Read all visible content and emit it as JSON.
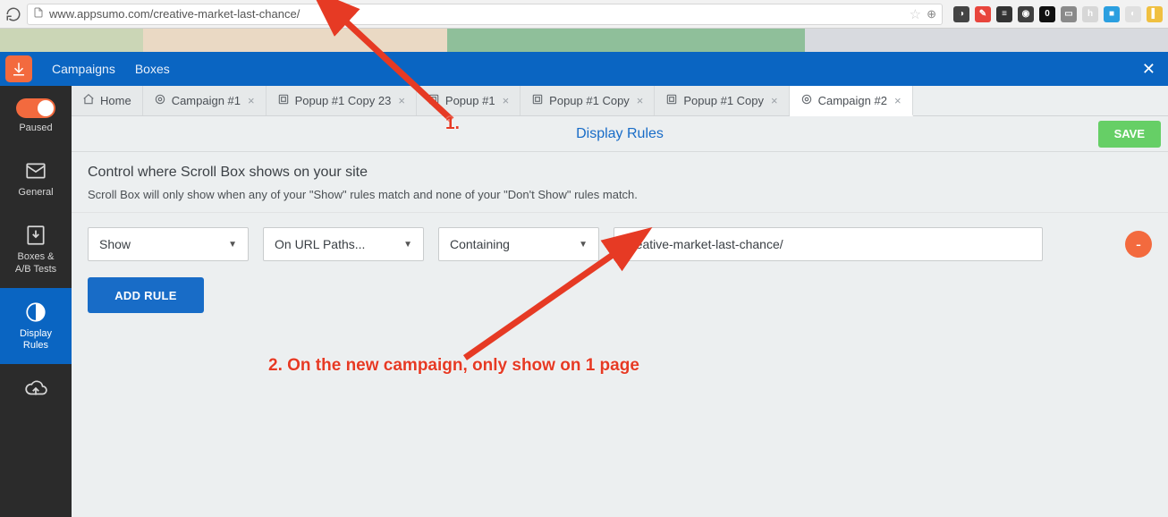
{
  "browser": {
    "url": "www.appsumo.com/creative-market-last-chance/",
    "ext_icons": [
      {
        "id": "pocket",
        "bg": "#444",
        "txt": "◑"
      },
      {
        "id": "tool",
        "bg": "#e8453c",
        "txt": "✎"
      },
      {
        "id": "buffer",
        "bg": "#333",
        "txt": "≡"
      },
      {
        "id": "circle",
        "bg": "#3f3f3f",
        "txt": "◉"
      },
      {
        "id": "op",
        "bg": "#111",
        "txt": "0"
      },
      {
        "id": "cast",
        "bg": "#8a8a8a",
        "txt": "▭"
      },
      {
        "id": "h",
        "bg": "#d7d7d7",
        "txt": "h"
      },
      {
        "id": "blue",
        "bg": "#2b9fe0",
        "txt": "■"
      },
      {
        "id": "globe",
        "bg": "#e0e0e0",
        "txt": "◐"
      },
      {
        "id": "flag",
        "bg": "#f0c040",
        "txt": "▌"
      }
    ]
  },
  "app": {
    "nav": {
      "campaigns": "Campaigns",
      "boxes": "Boxes"
    },
    "sidebar": {
      "paused": "Paused",
      "general": "General",
      "boxes": "Boxes &\nA/B Tests",
      "display": "Display\nRules"
    },
    "tabs": [
      {
        "type": "home",
        "label": "Home"
      },
      {
        "type": "target",
        "label": "Campaign #1"
      },
      {
        "type": "popup",
        "label": "Popup #1 Copy 23"
      },
      {
        "type": "popup",
        "label": "Popup #1"
      },
      {
        "type": "popup",
        "label": "Popup #1 Copy"
      },
      {
        "type": "popup",
        "label": "Popup #1 Copy"
      },
      {
        "type": "target",
        "label": "Campaign #2",
        "active": true
      }
    ],
    "header": {
      "title": "Display Rules",
      "save": "SAVE"
    },
    "desc": {
      "title": "Control where Scroll Box shows on your site",
      "body": "Scroll Box will only show when any of your \"Show\" rules match and none of your \"Don't Show\" rules match."
    },
    "rule": {
      "action": "Show",
      "path_type": "On URL Paths...",
      "match": "Containing",
      "value": "creative-market-last-chance/"
    },
    "add_rule": "ADD RULE"
  },
  "annotations": {
    "one": "1.",
    "two": "2. On the new campaign, only show on 1 page"
  }
}
